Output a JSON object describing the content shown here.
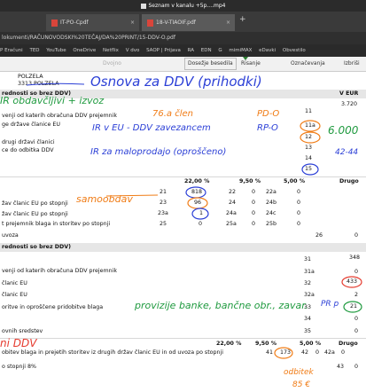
{
  "window": {
    "title": "Seznam v kanalu +5p....mp4"
  },
  "tabs": [
    {
      "label": "IT-PO-Cpdf"
    },
    {
      "label": "18-V-TIAOIF.pdf"
    }
  ],
  "address": {
    "url": "lokumenti/RAČUNOVODSKI%20TEČAJ/DA%20PRINT/15-DDV-O.pdf"
  },
  "bookmarks": [
    "P Eračuni",
    "TED",
    "YouTube",
    "OneDrive",
    "Netflix",
    "V dvo",
    "SAOP | Prijava",
    "RA",
    "EDN",
    "G",
    "mimiMAX",
    "eDavki",
    "Obvestilo"
  ],
  "pdf_toolbar": {
    "zoom_hint": "Dvojno",
    "fit_label": "Dosežje besedila",
    "draw_label": "Risanje",
    "annotate_label": "Označevanja",
    "erase_label": "Izbriši"
  },
  "document": {
    "address_line1": "POLZELA",
    "address_line2": "3313 POLZELA",
    "col_veur": "V EUR",
    "val_3720": "3.720",
    "line_obracuna": "venji od katerih obračuna DDV prejemnik",
    "line_eu": "ge države članice EU",
    "line_drugi": "drugi državi članici",
    "line_odbitka": "ce do odbitka DDV",
    "line_a_11": "11",
    "line_a_11a": "11a",
    "line_a_12": "12",
    "line_a_13": "13",
    "line_a_14": "14",
    "line_a_15": "15",
    "rate_22": "22,00 %",
    "rate_95": "9,50 %",
    "rate_5": "5,00 %",
    "drugo": "Drugo",
    "row1_label": "žav članic EU po stopnji",
    "row1_code": "21",
    "row1_val": "818",
    "row1_c2": "22",
    "row1_v2": "0",
    "row1_c3": "22a",
    "row1_v3": "0",
    "row2_label": "žav članic EU po stopnji",
    "row2_code": "23",
    "row2_val": "96",
    "row2_c2": "24",
    "row2_v2": "0",
    "row2_c3": "24b",
    "row2_v3": "0",
    "row3_label": "t prejemnik blaga in storitev po stopnji",
    "row3_code": "23a",
    "row3_val": "1",
    "row3_c2": "24a",
    "row3_v2": "0",
    "row3_c3": "24c",
    "row3_v3": "0",
    "row4_code": "25",
    "row4_val": "0",
    "row4_c2": "25a",
    "row4_v2": "0",
    "row4_c3": "25b",
    "row4_v3": "0",
    "uvoza_label": "uvoza",
    "uvoza_code": "26",
    "uvoza_val": "0",
    "section2": "rednosti so brez DDV)",
    "section1": "rednosti so brez DDV)",
    "s2_obracuna": "venji od katerih obračuna DDV prejemnik",
    "s2_clanic": "članic EU",
    "s2_clanic2": "članic EU",
    "s2_oprosc": "oritve in oproščene pridobitve blaga",
    "s2_sredstev": "ovnih sredstev",
    "s2_31": "31",
    "s2_31a": "31a",
    "s2_32": "32",
    "s2_32a": "32a",
    "s2_33": "33",
    "s2_34": "34",
    "s2_35": "35",
    "s2_v31": "348",
    "s2_v31a": "0",
    "s2_v32": "433",
    "s2_v32a": "2",
    "s2_v33": "21",
    "s2_v34": "0",
    "s2_v35": "0",
    "bot_rate22": "22,00 %",
    "bot_rate95": "9,50 %",
    "bot_rate5": "5,00 %",
    "bot_drugo": "Drugo",
    "bot_line": "obitev blaga in prejetih storitev iz drugih držav članic EU in od uvoza po stopnji",
    "bot_c1": "41",
    "bot_v1": "173",
    "bot_c2": "42",
    "bot_v2": "0",
    "bot_c3": "42a",
    "bot_v3": "0",
    "bot_line2": "o stopnji 8%",
    "bot_c4": "43",
    "bot_v4": "0"
  },
  "annotations": {
    "title": "Osnova za DDV (prihodki)",
    "ir_line": "IR obdavčljivi + izvoz",
    "clen": "76.a člen",
    "pd": "PD-O",
    "ir_eu": "IR v EU - DDV zavezancem",
    "rp": "RP-O",
    "big_number": "6.000",
    "ir_maloprodaja": "IR za maloprodajo (oproščeno)",
    "num_42": "42-44",
    "samoobdav": "samoobdav",
    "provizije": "provizije banke, bančne obr., zavar.",
    "pr": "PR p",
    "ddv": "ni DDV",
    "odbitek": "odbitek",
    "bottom": "85 €"
  },
  "colors": {
    "blue": "#2b3fd6",
    "orange": "#f07c16",
    "green": "#1f9a3f",
    "red": "#e53a2e"
  }
}
